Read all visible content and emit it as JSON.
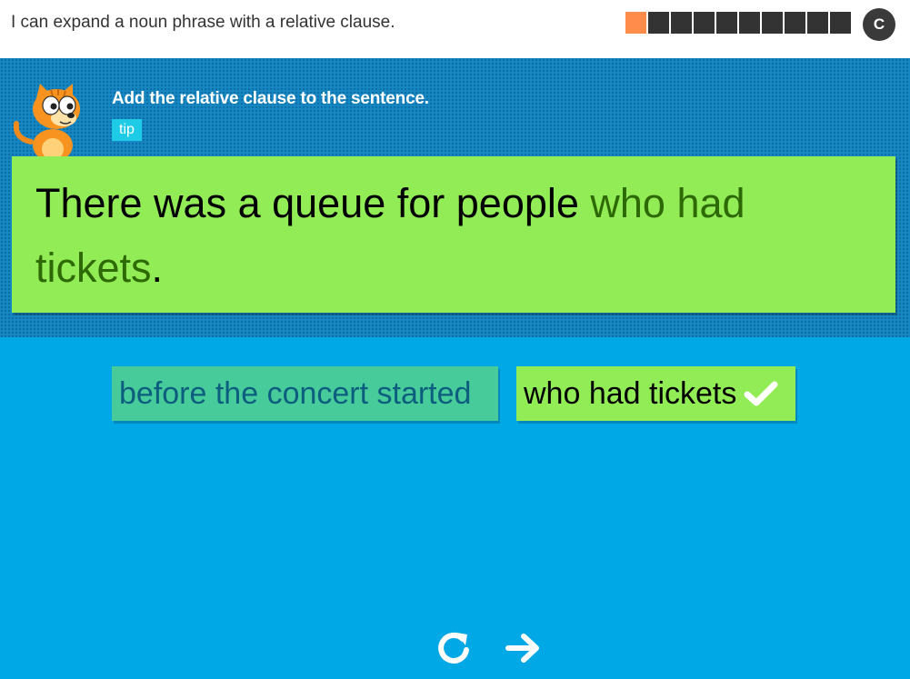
{
  "header": {
    "objective": "I can expand a noun phrase with a relative clause.",
    "progress": {
      "total": 10,
      "completed": 1
    },
    "menu_button_label": "C"
  },
  "question": {
    "instruction": "Add the relative clause to the sentence.",
    "tip_label": "tip",
    "sentence_before": "There was a queue for people ",
    "sentence_filled": "who had tickets",
    "sentence_after": "."
  },
  "options": [
    {
      "label": "before the concert started",
      "state": "incorrect"
    },
    {
      "label": "who had tickets",
      "state": "correct"
    }
  ],
  "icons": {
    "mascot": "cat-mascot-icon",
    "check": "check-icon",
    "retry": "retry-icon",
    "next": "arrow-right-icon"
  },
  "colors": {
    "background": "#00a8e6",
    "panel": "#1587c2",
    "green_card": "#92ec56",
    "filled_text": "#2d6a06",
    "teal_option": "#48cb9a",
    "progress_done": "#ff8c4b",
    "progress_todo": "#333333"
  }
}
